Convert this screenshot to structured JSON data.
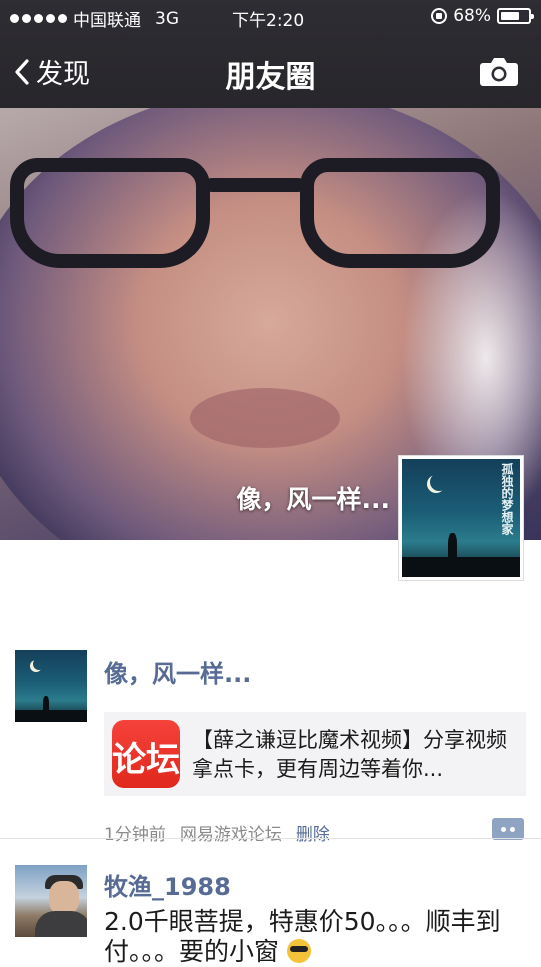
{
  "status_bar": {
    "carrier": "中国联通",
    "network": "3G",
    "time": "下午2:20",
    "battery_text": "68%",
    "battery_level": 0.68
  },
  "nav": {
    "back_label": "发现",
    "title": "朋友圈",
    "camera_icon": "camera-icon"
  },
  "cover": {
    "user_name": "像，风一样..."
  },
  "avatar_art": {
    "title": "孤独的梦想家"
  },
  "posts": [
    {
      "author": "像，风一样...",
      "link": {
        "icon_text": "论坛",
        "text": "【薛之谦逗比魔术视频】分享视频拿点卡，更有周边等着你..."
      },
      "time": "1分钟前",
      "source": "网易游戏论坛",
      "delete_label": "删除"
    },
    {
      "author": "牧渔_1988",
      "text": "2.0千眼菩提，特惠价50。。。顺丰到付。。。要的小窗"
    }
  ],
  "colors": {
    "name_link": "#576b95",
    "nav_bg": "#2e2d33"
  }
}
